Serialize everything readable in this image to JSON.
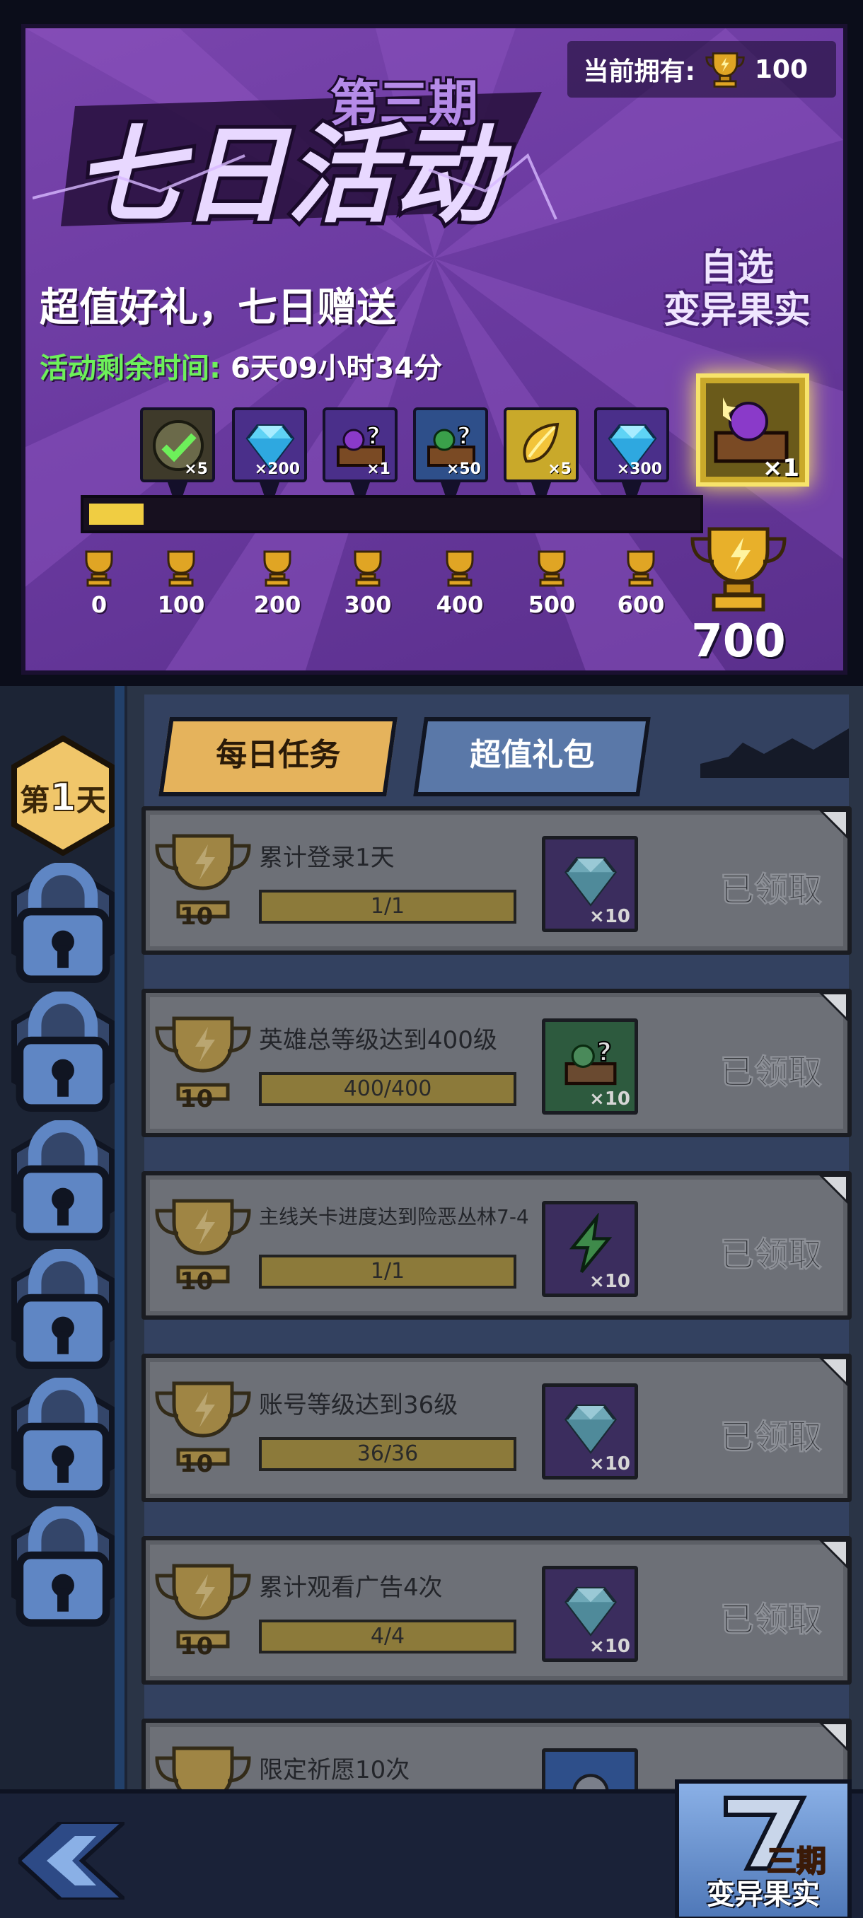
{
  "banner": {
    "owned_label": "当前拥有:",
    "owned_value": "100",
    "period": "第三期",
    "title": "七日活动",
    "subtitle": "超值好礼，七日赠送",
    "timer_label": "活动剩余时间:",
    "timer_value": "6天09小时34分",
    "select_label_1": "自选",
    "select_label_2": "变异果实",
    "progress_fraction": 0.09,
    "rewards": [
      {
        "icon": "check-token-icon",
        "qty": "×5",
        "bg": "#3e3a2a"
      },
      {
        "icon": "diamond-icon",
        "qty": "×200",
        "bg": "#4a2f8a"
      },
      {
        "icon": "mystery-chest-purple-icon",
        "qty": "×1",
        "bg": "#4a2f8a"
      },
      {
        "icon": "mystery-chest-green-icon",
        "qty": "×50",
        "bg": "#2e4f8a"
      },
      {
        "icon": "golden-fruit-icon",
        "qty": "×5",
        "bg": "#c9a92a"
      },
      {
        "icon": "diamond-icon",
        "qty": "×300",
        "bg": "#4a2f8a"
      }
    ],
    "big_reward_qty": "×1",
    "milestones": [
      "0",
      "100",
      "200",
      "300",
      "400",
      "500",
      "600"
    ],
    "final_milestone": "700"
  },
  "days": {
    "active_prefix": "第",
    "active_num": "1",
    "active_suffix": "天",
    "locked_label": "第天"
  },
  "tabs": {
    "daily": "每日任务",
    "pack": "超值礼包"
  },
  "tasks": [
    {
      "points": "10",
      "desc": "累计登录1天",
      "progress": "1/1",
      "item_icon": "diamond-icon",
      "item_qty": "×10",
      "item_bg": "#3b2d5e",
      "status": "已领取"
    },
    {
      "points": "10",
      "desc": "英雄总等级达到400级",
      "progress": "400/400",
      "item_icon": "mystery-chest-green-icon",
      "item_qty": "×10",
      "item_bg": "#2d5a3e",
      "status": "已领取"
    },
    {
      "points": "10",
      "desc": "主线关卡进度达到险恶丛林7-4",
      "progress": "1/1",
      "item_icon": "energy-bolt-icon",
      "item_qty": "×10",
      "item_bg": "#3b2d5e",
      "status": "已领取"
    },
    {
      "points": "10",
      "desc": "账号等级达到36级",
      "progress": "36/36",
      "item_icon": "diamond-icon",
      "item_qty": "×10",
      "item_bg": "#3b2d5e",
      "status": "已领取"
    },
    {
      "points": "10",
      "desc": "累计观看广告4次",
      "progress": "4/4",
      "item_icon": "diamond-icon",
      "item_qty": "×10",
      "item_bg": "#3b2d5e",
      "status": "已领取"
    },
    {
      "points": "",
      "desc": "限定祈愿10次",
      "progress": "",
      "item_icon": "wish-token-icon",
      "item_qty": "",
      "item_bg": "#2e4f8a",
      "status": ""
    }
  ],
  "footer": {
    "mutation_tag": "三期",
    "mutation_label": "变异果实"
  }
}
